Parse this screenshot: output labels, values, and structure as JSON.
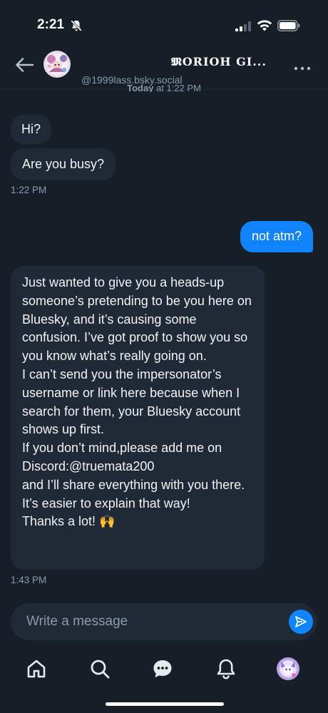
{
  "status_bar": {
    "time": "2:21",
    "icons": [
      "bell-off-icon",
      "signal-icon",
      "wifi-icon",
      "battery-icon"
    ]
  },
  "header": {
    "display_name": "𝕸ORIOH   GI...",
    "handle": "@1999lass.bsky.social",
    "icons": [
      "back-arrow-icon",
      "avatar",
      "more-dots-icon"
    ]
  },
  "day_separator": {
    "day": "Today",
    "rest": " at 1:22 PM"
  },
  "messages": [
    {
      "from": "them",
      "text": "Hi?"
    },
    {
      "from": "them",
      "text": "Are you busy?"
    },
    {
      "from": "them",
      "time": "1:22 PM"
    },
    {
      "from": "me",
      "text": "not atm?"
    },
    {
      "from": "them",
      "text": "Just wanted to give you a heads-up someone’s pretending to be you here on Bluesky, and it’s causing some confusion. I’ve got proof to show you so you know what’s really going on.\nI can’t send you the impersonator’s username or link here because when I search for them, your Bluesky account shows up first.\nIf you don’t mind,please add me on Discord:@truemata200\nand I’ll share everything with you there. It’s easier to explain that way!\nThanks a lot! 🙌"
    },
    {
      "from": "them",
      "time": "1:43 PM"
    }
  ],
  "composer": {
    "placeholder": "Write a message",
    "value": ""
  },
  "tabbar": {
    "items": [
      "home-icon",
      "search-icon",
      "chat-icon",
      "notifications-icon",
      "profile-avatar"
    ]
  },
  "colors": {
    "background": "#161e27",
    "bubble_in": "#1f2a36",
    "bubble_out": "#1083fe",
    "muted_text": "#8c9aab"
  }
}
